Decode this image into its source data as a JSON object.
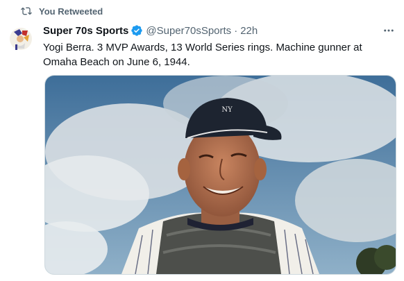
{
  "retweet": {
    "label": "You Retweeted",
    "icon": "retweet-icon"
  },
  "tweet": {
    "author_name": "Super 70s Sports",
    "verified": true,
    "handle": "@Super70sSports",
    "separator": "·",
    "time": "22h",
    "text": "Yogi Berra. 3 MVP Awards, 13 World Series rings. Machine gunner at Omaha Beach on June 6, 1944.",
    "avatar_icon": "super-70s-sports-logo",
    "media_icon": "photo-yogi-berra"
  },
  "colors": {
    "text_primary": "#0f1419",
    "text_secondary": "#536471",
    "verified_blue": "#1d9bf0"
  }
}
